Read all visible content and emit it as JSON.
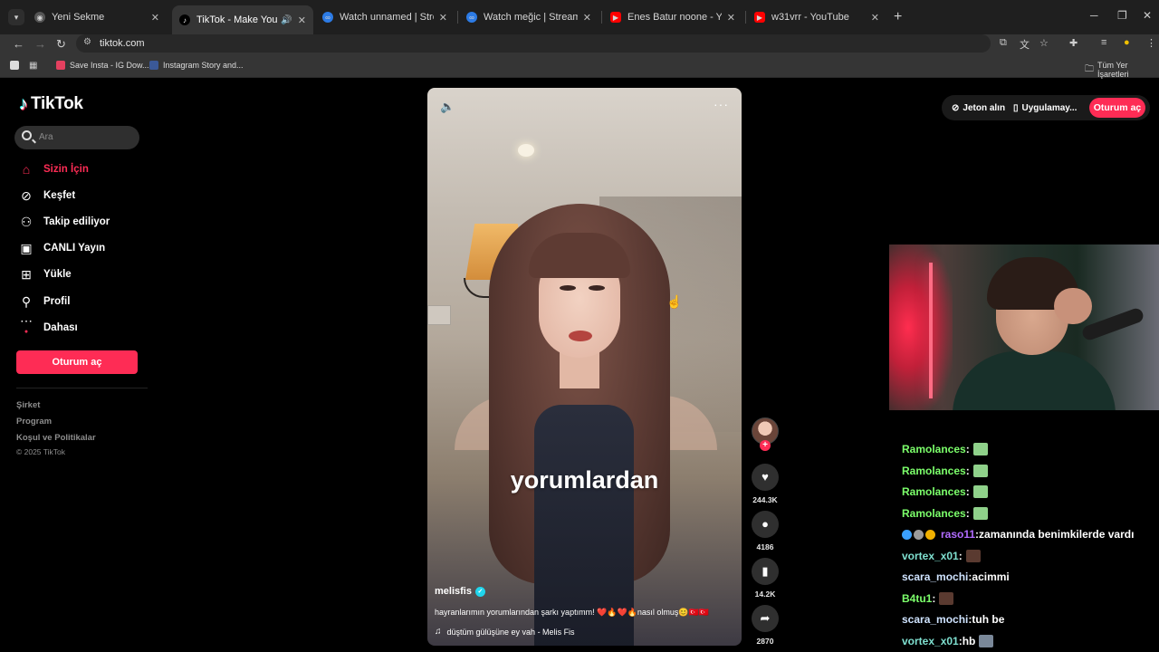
{
  "browser": {
    "tabs": [
      {
        "title": "Yeni Sekme",
        "icon": "chrome-icon",
        "active": false
      },
      {
        "title": "TikTok - Make Your Day",
        "icon": "tiktok-icon",
        "active": true
      },
      {
        "title": "Watch unnamed | Streamable",
        "icon": "streamable-icon",
        "active": false
      },
      {
        "title": "Watch meğic | Streamable",
        "icon": "streamable-icon",
        "active": false
      },
      {
        "title": "Enes Batur noone - YouTube",
        "icon": "youtube-icon",
        "active": false
      },
      {
        "title": "w31vrr - YouTube",
        "icon": "youtube-icon",
        "active": false
      }
    ],
    "url": "tiktok.com",
    "bookmarks": [
      {
        "title": "Save Insta - IG Dow..."
      },
      {
        "title": "Instagram Story and..."
      }
    ],
    "all_bookmarks": "Tüm Yer İşaretleri",
    "colors": {
      "tabbar": "#1f1f1f",
      "toolbar": "#353535"
    }
  },
  "tiktok": {
    "brand": "TikTok",
    "search_placeholder": "Ara",
    "nav": [
      {
        "label": "Sizin İçin",
        "icon": "home-icon",
        "active": true
      },
      {
        "label": "Keşfet",
        "icon": "compass-icon",
        "active": false
      },
      {
        "label": "Takip ediliyor",
        "icon": "following-icon",
        "active": false
      },
      {
        "label": "CANLI Yayın",
        "icon": "live-icon",
        "active": false
      },
      {
        "label": "Yükle",
        "icon": "upload-icon",
        "active": false
      },
      {
        "label": "Profil",
        "icon": "profile-icon",
        "active": false
      },
      {
        "label": "Dahası",
        "icon": "more-icon",
        "active": false
      }
    ],
    "login_label": "Oturum aç",
    "footer": [
      "Şirket",
      "Program",
      "Koşul ve Politikalar"
    ],
    "copyright": "© 2025 TikTok",
    "header": {
      "coins": "Jeton alın",
      "app": "Uygulamay...",
      "login": "Oturum aç"
    },
    "accent": "#fe2c55",
    "video": {
      "overlay_text": "yorumlardan",
      "author": "melisfis",
      "description": "hayranlarımın yorumlarından şarkı yaptımm! ❤️🔥❤️🔥nasıl olmuş😊🇹🇷🇹🇷",
      "music": "düştüm gülüşüne ey vah - Melis Fis",
      "likes": "244.3K",
      "comments": "4186",
      "saves": "14.2K",
      "shares": "2870"
    }
  },
  "chat": [
    {
      "user": "Ramolances",
      "color": "#7cff6b",
      "sep": " :",
      "msg": "",
      "emote": "#8fd18a",
      "badges": []
    },
    {
      "user": "Ramolances",
      "color": "#7cff6b",
      "sep": " :",
      "msg": "",
      "emote": "#8fd18a",
      "badges": []
    },
    {
      "user": "Ramolances",
      "color": "#7cff6b",
      "sep": " :",
      "msg": "",
      "emote": "#8fd18a",
      "badges": []
    },
    {
      "user": "Ramolances",
      "color": "#7cff6b",
      "sep": " :",
      "msg": "",
      "emote": "#8fd18a",
      "badges": []
    },
    {
      "user": "raso11",
      "color": "#b26cff",
      "sep": " :",
      "msg": " zamanında benimkilerde vardı",
      "emote": "",
      "badges": [
        "#3aa0ff",
        "#9a9a9a",
        "#f0b000"
      ]
    },
    {
      "user": "vortex_x01",
      "color": "#7fe0d0",
      "sep": " :",
      "msg": "",
      "emote": "#5a3a30",
      "badges": []
    },
    {
      "user": "scara_mochi",
      "color": "#cfe3ff",
      "sep": " :",
      "msg": " acimmi",
      "emote": "",
      "badges": []
    },
    {
      "user": "B4tu1",
      "color": "#7cff6b",
      "sep": " :",
      "msg": "",
      "emote": "#5a3a30",
      "badges": []
    },
    {
      "user": "scara_mochi",
      "color": "#cfe3ff",
      "sep": " :",
      "msg": " tuh be",
      "emote": "",
      "badges": []
    },
    {
      "user": "vortex_x01",
      "color": "#7fe0d0",
      "sep": " :",
      "msg": " hb",
      "emote": "#7a8899",
      "badges": []
    }
  ]
}
